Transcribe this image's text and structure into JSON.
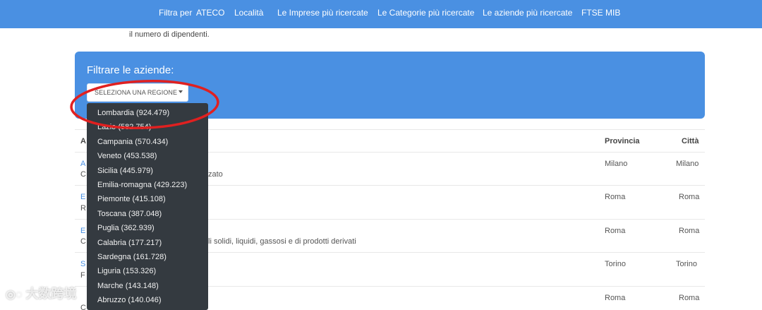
{
  "nav": {
    "items": [
      "Filtra per",
      "ATECO",
      "Località",
      "Le Imprese più ricercate",
      "Le Categorie più ricercate",
      "Le aziende più ricercate",
      "FTSE MIB"
    ]
  },
  "description": "il numero di dipendenti.",
  "filter": {
    "title": "Filtrare le aziende:",
    "button_label": "SELEZIONA UNA REGIONE"
  },
  "dropdown": {
    "options": [
      "Lombardia (924.479)",
      "Lazio (582.754)",
      "Campania (570.434)",
      "Veneto (453.538)",
      "Sicilia (445.979)",
      "Emilia-romagna (429.223)",
      "Piemonte (415.108)",
      "Toscana (387.048)",
      "Puglia (362.939)",
      "Calabria (177.217)",
      "Sardegna (161.728)",
      "Liguria (153.326)",
      "Marche (143.148)",
      "Abruzzo (140.046)"
    ]
  },
  "table": {
    "headers": {
      "col1": "A",
      "provincia": "Provincia",
      "citta": "Città"
    },
    "rows": [
      {
        "name": "A",
        "desc": "C",
        "desc_tail": "zato",
        "provincia": "Milano",
        "citta": "Milano"
      },
      {
        "name": "E",
        "desc": "R",
        "desc_tail": "",
        "provincia": "Roma",
        "citta": "Roma"
      },
      {
        "name": "E",
        "desc": "C",
        "desc_tail": "li solidi, liquidi, gassosi e di prodotti derivati",
        "provincia": "Roma",
        "citta": "Roma"
      },
      {
        "name": "S",
        "desc": "F",
        "desc_tail": "",
        "provincia": "Torino",
        "citta": "Torino"
      },
      {
        "name": "",
        "desc": "C",
        "desc_tail": "",
        "provincia": "Roma",
        "citta": "Roma"
      }
    ]
  },
  "watermark": "大数跨境",
  "colors": {
    "primary": "#4a90e2",
    "dropdown_bg": "#343a40",
    "highlight": "#e02020"
  }
}
